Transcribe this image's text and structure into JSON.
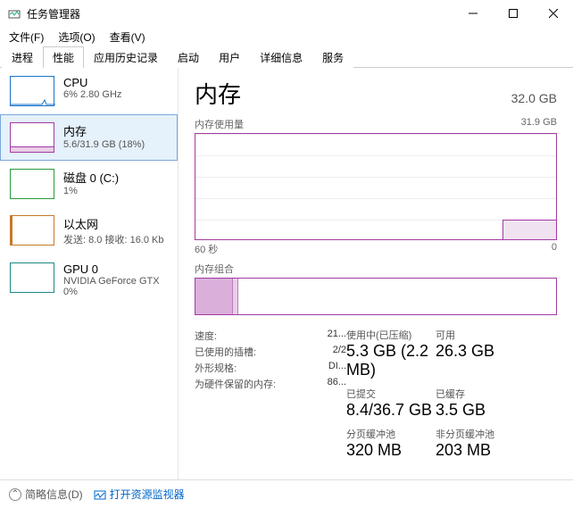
{
  "window": {
    "title": "任务管理器"
  },
  "menu": {
    "file": "文件(F)",
    "options": "选项(O)",
    "view": "查看(V)"
  },
  "tabs": [
    "进程",
    "性能",
    "应用历史记录",
    "启动",
    "用户",
    "详细信息",
    "服务"
  ],
  "active_tab": 1,
  "sidebar": {
    "items": [
      {
        "title": "CPU",
        "sub": "6% 2.80 GHz"
      },
      {
        "title": "内存",
        "sub": "5.6/31.9 GB (18%)"
      },
      {
        "title": "磁盘 0 (C:)",
        "sub": "1%"
      },
      {
        "title": "以太网",
        "sub": "发送: 8.0 接收: 16.0 Kb"
      },
      {
        "title": "GPU 0",
        "sub": "NVIDIA GeForce GTX\n0%"
      }
    ],
    "selected": 1
  },
  "main": {
    "heading": "内存",
    "capacity": "32.0 GB",
    "usage_label": "内存使用量",
    "usage_max": "31.9 GB",
    "x_left": "60 秒",
    "x_right": "0",
    "composition_label": "内存组合",
    "stats": {
      "in_use_label": "使用中(已压缩)",
      "in_use_value": "5.3 GB (2.2 MB)",
      "available_label": "可用",
      "available_value": "26.3 GB",
      "committed_label": "已提交",
      "committed_value": "8.4/36.7 GB",
      "cached_label": "已缓存",
      "cached_value": "3.5 GB",
      "paged_label": "分页缓冲池",
      "paged_value": "320 MB",
      "nonpaged_label": "非分页缓冲池",
      "nonpaged_value": "203 MB",
      "speed_label": "速度:",
      "speed_value": "21...",
      "slots_label": "已使用的插槽:",
      "slots_value": "2/2",
      "form_label": "外形规格:",
      "form_value": "DI...",
      "reserved_label": "为硬件保留的内存:",
      "reserved_value": "86..."
    }
  },
  "footer": {
    "fewer": "简略信息(D)",
    "monitor": "打开资源监视器"
  },
  "chart_data": {
    "type": "area",
    "title": "内存使用量",
    "ylabel": "GB",
    "ylim": [
      0,
      31.9
    ],
    "x_range_seconds": [
      60,
      0
    ],
    "series": [
      {
        "name": "使用中",
        "approx_current": 5.6,
        "approx_shape": "flat_low_then_small_step_up_at_right"
      }
    ]
  }
}
